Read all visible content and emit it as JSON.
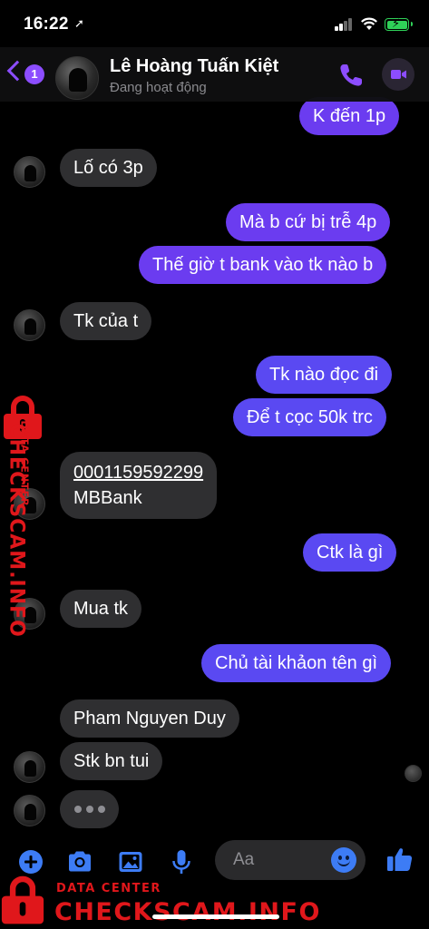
{
  "status_bar": {
    "time": "16:22",
    "location_glyph": "➚"
  },
  "header": {
    "unread_count": "1",
    "contact_name": "Lê Hoàng Tuấn Kiệt",
    "contact_status": "Đang hoạt động",
    "accent_color": "#8c4dff"
  },
  "messages": [
    {
      "dir": "out",
      "text": "K đến 1p"
    },
    {
      "dir": "in",
      "text": "Lố có 3p"
    },
    {
      "dir": "out",
      "text": "Mà b cứ bị trễ 4p"
    },
    {
      "dir": "out",
      "text": "Thế giờ t bank vào tk nào b"
    },
    {
      "dir": "in",
      "text": "Tk của t"
    },
    {
      "dir": "out",
      "text": "Tk nào đọc đi"
    },
    {
      "dir": "out",
      "text": "Để t cọc 50k trc"
    },
    {
      "dir": "in",
      "text_line1": "0001159592299",
      "text_line2": "MBBank"
    },
    {
      "dir": "out",
      "text": "Ctk là gì"
    },
    {
      "dir": "in",
      "text": "Mua tk"
    },
    {
      "dir": "out",
      "text": "Chủ tài khảon tên gì"
    },
    {
      "dir": "in",
      "text": "Pham Nguyen Duy"
    },
    {
      "dir": "in",
      "text": "Stk bn tui"
    }
  ],
  "composer": {
    "placeholder": "Aa"
  },
  "watermark": {
    "small": "DATA CENTER",
    "big": "CHECKSCAM.INFO",
    "color": "#e0171b"
  },
  "icons": [
    "location-arrow-icon",
    "signal-icon",
    "wifi-icon",
    "battery-icon",
    "back-chevron-icon",
    "phone-icon",
    "video-icon",
    "plus-icon",
    "camera-icon",
    "image-icon",
    "microphone-icon",
    "emoji-icon",
    "thumbs-up-icon",
    "lock-icon"
  ]
}
